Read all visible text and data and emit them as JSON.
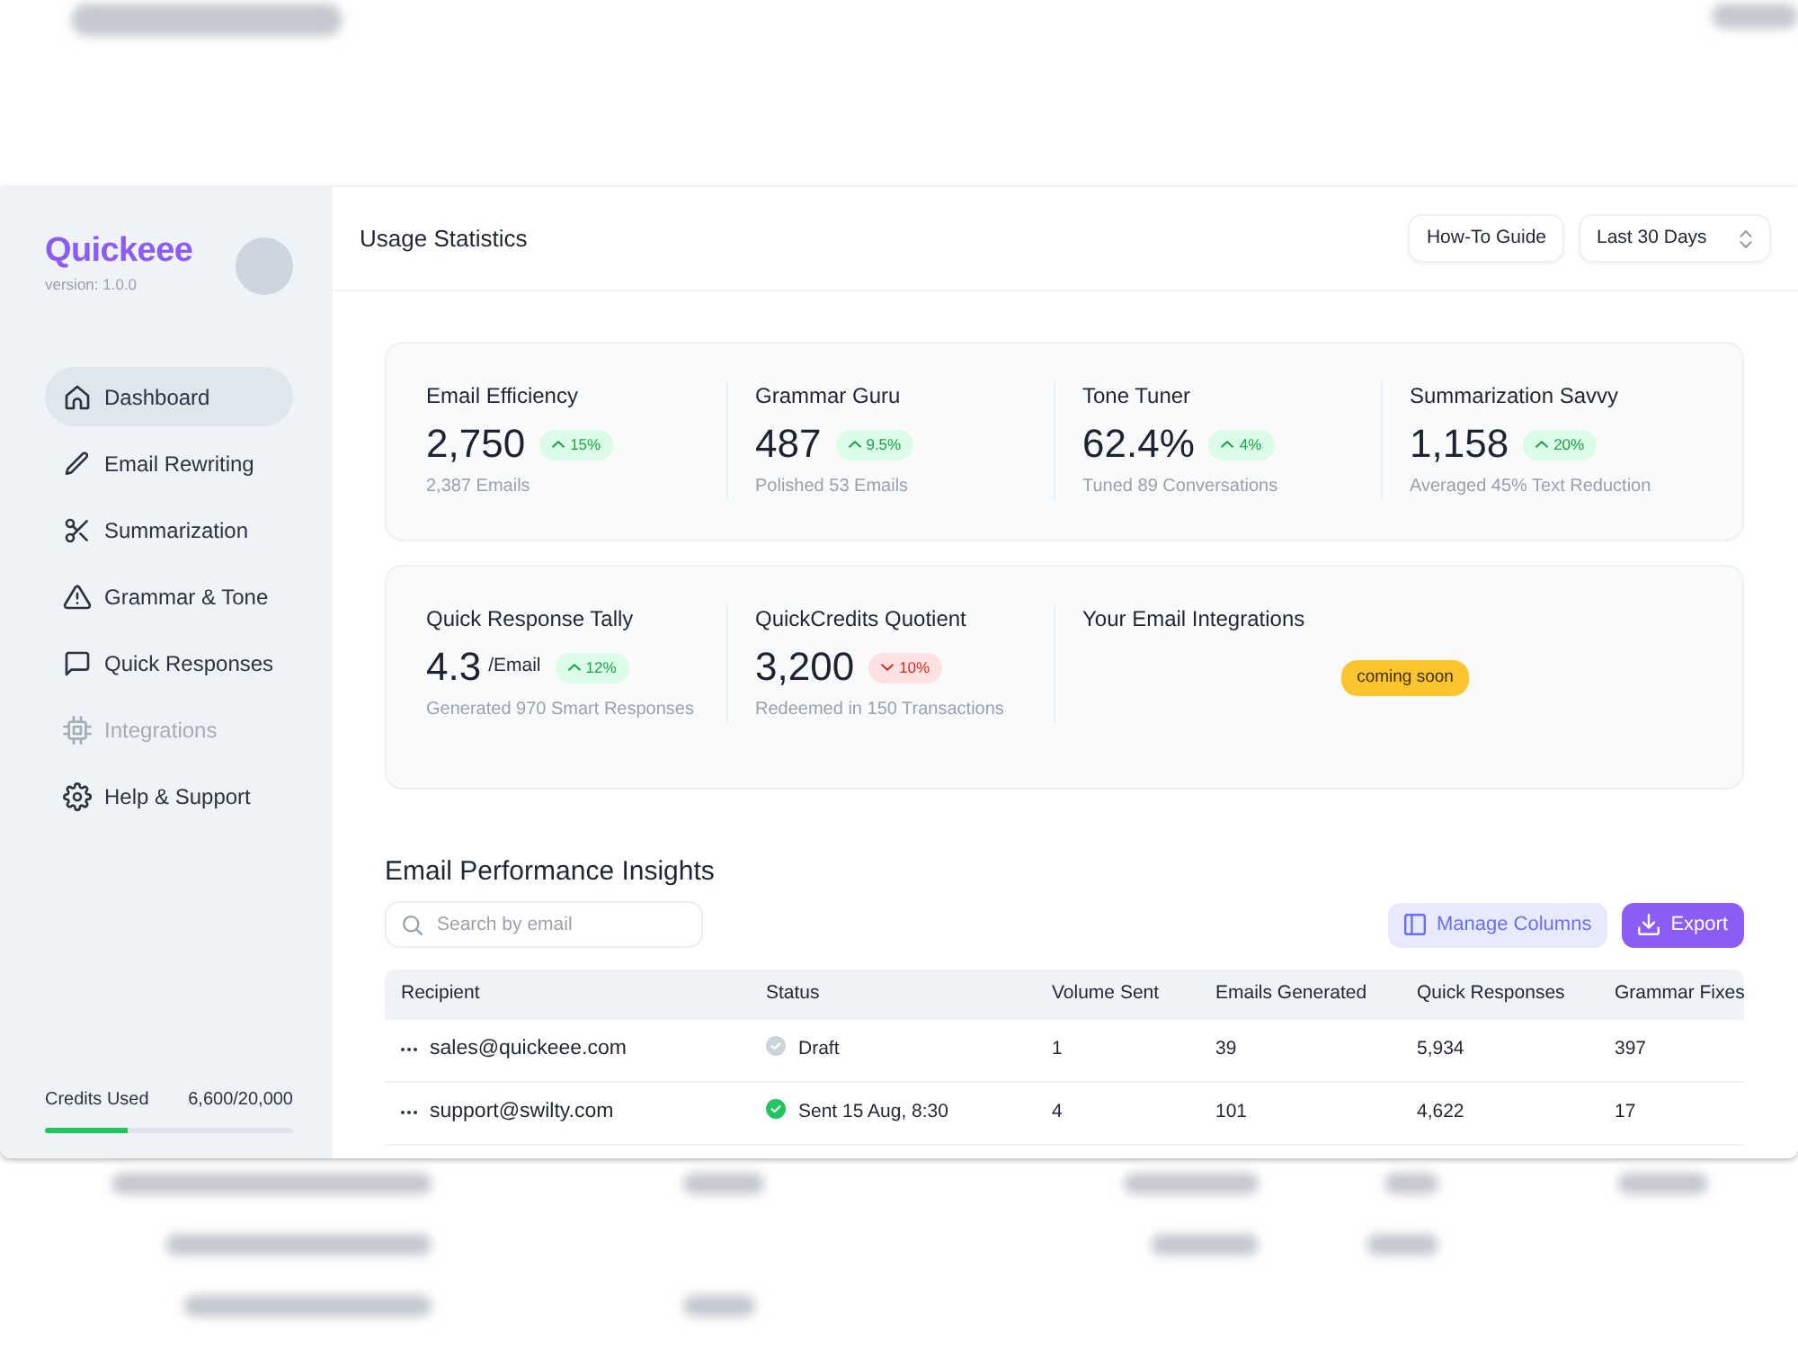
{
  "sidebar": {
    "logo": "Quickeee",
    "version": "version: 1.0.0",
    "nav": [
      {
        "label": "Dashboard",
        "selected": true,
        "disabled": false
      },
      {
        "label": "Email Rewriting",
        "selected": false,
        "disabled": false
      },
      {
        "label": "Summarization",
        "selected": false,
        "disabled": false
      },
      {
        "label": "Grammar & Tone",
        "selected": false,
        "disabled": false
      },
      {
        "label": "Quick Responses",
        "selected": false,
        "disabled": false
      },
      {
        "label": "Integrations",
        "selected": false,
        "disabled": true
      },
      {
        "label": "Help & Support",
        "selected": false,
        "disabled": false
      }
    ],
    "credits": {
      "label": "Credits Used",
      "reading": "6,600/20,000",
      "level": 0.33
    }
  },
  "header": {
    "title": "Usage Statistics",
    "guide_button": "How-To Guide",
    "period_select": "Last 30 Days"
  },
  "stat_cards": [
    {
      "items": [
        {
          "kind": "metric",
          "title": "Email Efficiency",
          "value": "2,750",
          "trend": {
            "rising": true,
            "text": "15%"
          },
          "caption": "2,387 Emails"
        },
        {
          "kind": "metric",
          "title": "Grammar Guru",
          "value": "487",
          "trend": {
            "rising": true,
            "text": "9.5%"
          },
          "caption": "Polished 53 Emails"
        },
        {
          "kind": "metric",
          "title": "Tone Tuner",
          "value": "62.4%",
          "trend": {
            "rising": true,
            "text": "4%"
          },
          "caption": "Tuned 89 Conversations"
        },
        {
          "kind": "metric",
          "title": "Summarization Savvy",
          "value": "1,158",
          "trend": {
            "rising": true,
            "text": "20%"
          },
          "caption": "Averaged 45% Text Reduction"
        }
      ]
    },
    {
      "items": [
        {
          "kind": "metric",
          "title": "Quick Response Tally",
          "value": "4.3",
          "unit": "/Email",
          "trend": {
            "rising": true,
            "text": "12%"
          },
          "caption": "Generated 970 Smart Responses"
        },
        {
          "kind": "metric",
          "title": "QuickCredits Quotient",
          "value": "3,200",
          "trend": {
            "rising": false,
            "text": "10%"
          },
          "caption": "Redeemed in 150 Transactions"
        },
        {
          "kind": "placeholder",
          "title": "Your Email Integrations",
          "badge": "coming soon"
        }
      ]
    }
  ],
  "insights": {
    "title": "Email Performance Insights",
    "search": {
      "placeholder": "Search by email"
    },
    "manage_button": "Manage Columns",
    "export_button": "Export",
    "table": {
      "columns": [
        "Recipient",
        "Status",
        "Volume Sent",
        "Emails Generated",
        "Quick Responses",
        "Grammar Fixes"
      ],
      "rows": [
        {
          "recipient": "sales@quickeee.com",
          "status": {
            "kind": "draft",
            "label": "Draft"
          },
          "volume_sent": "1",
          "emails_generated": "39",
          "quick_responses": "5,934",
          "grammar_fixes": "397"
        },
        {
          "recipient": "support@swilty.com",
          "status": {
            "kind": "sent",
            "label": "Sent 15 Aug, 8:30"
          },
          "volume_sent": "4",
          "emails_generated": "101",
          "quick_responses": "4,622",
          "grammar_fixes": "17"
        }
      ]
    }
  }
}
